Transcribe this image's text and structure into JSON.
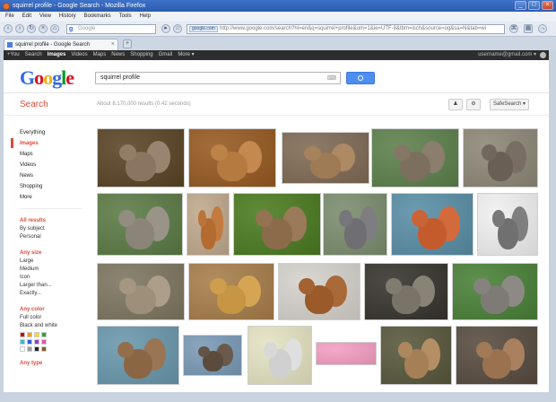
{
  "window": {
    "title": "squirrel profile - Google Search - Mozilla Firefox",
    "controls": [
      "_",
      "□",
      "×"
    ]
  },
  "menubar": [
    "File",
    "Edit",
    "View",
    "History",
    "Bookmarks",
    "Tools",
    "Help"
  ],
  "toolbar": {
    "search_placeholder": "Google",
    "url_site": "google.com",
    "url": "http://www.google.com/search?hl=en&q=squirrel+profile&um=1&ie=UTF-8&tbm=isch&source=og&sa=N&tab=wi"
  },
  "tab": {
    "title": "squirrel profile - Google Search",
    "close": "×"
  },
  "gbar": {
    "items": [
      "+You",
      "Search",
      "Images",
      "Videos",
      "Maps",
      "News",
      "Shopping",
      "Gmail",
      "More ▾"
    ],
    "active_index": 2,
    "account": "username@gmail.com ▾"
  },
  "header": {
    "logo": [
      "G",
      "o",
      "o",
      "g",
      "l",
      "e"
    ],
    "query": "squirrel profile",
    "keyboard_icon": "⌨"
  },
  "subhead": {
    "label": "Search",
    "stats": "About 8,170,000 results (0.42 seconds)",
    "safesearch": "SafeSearch ▾"
  },
  "sidebar": {
    "links": [
      "Everything",
      "Images",
      "Maps",
      "Videos",
      "News",
      "Shopping",
      "More"
    ],
    "selected_index": 1,
    "sections": [
      {
        "title": "All results",
        "items": [
          "By subject",
          "Personal"
        ]
      },
      {
        "title": "Any size",
        "items": [
          "Large",
          "Medium",
          "Icon",
          "Larger than...",
          "Exactly..."
        ]
      },
      {
        "title": "Any color",
        "items": [
          "Full color",
          "Black and white"
        ]
      }
    ],
    "swatches": [
      "#cc0000",
      "#f39c12",
      "#f1e00e",
      "#2fa43b",
      "#1ec5d6",
      "#2f5bd8",
      "#9b3cc8",
      "#e75aa8",
      "#ffffff",
      "#9a9a9a",
      "#222222",
      "#8b5a2b"
    ],
    "footer_title": "Any type"
  },
  "colors": {
    "brand_red": "#dd4b39",
    "blue": "#4d8ef0",
    "link": "#222222"
  },
  "results": [
    {
      "bg": "#6d5a3e",
      "fur": "#8a7660"
    },
    {
      "bg": "#a26d3a",
      "fur": "#b57a3f"
    },
    {
      "bg": "#8e7c68",
      "fur": "#9e7a55"
    },
    {
      "bg": "#6f8f61",
      "fur": "#7c6f5e"
    },
    {
      "bg": "#9a9586",
      "fur": "#6a5f54"
    },
    {
      "bg": "#6e8a5b",
      "fur": "#8a8578"
    },
    {
      "bg": "#c7b39a",
      "fur": "#b36b2f"
    },
    {
      "bg": "#5f8a3a",
      "fur": "#8c6b4b"
    },
    {
      "bg": "#8a9a7e",
      "fur": "#6f6e72"
    },
    {
      "bg": "#6c9bb0",
      "fur": "#c45b2d"
    },
    {
      "bg": "#f2f2f2",
      "fur": "#707070"
    },
    {
      "bg": "#8c8572",
      "fur": "#9e8f7a"
    },
    {
      "bg": "#b08c5e",
      "fur": "#c79645"
    },
    {
      "bg": "#dad7d2",
      "fur": "#9a5a2a"
    },
    {
      "bg": "#4e4a45",
      "fur": "#7a7468"
    },
    {
      "bg": "#5e8f4e",
      "fur": "#7e7b76"
    },
    {
      "bg": "#7aa3b5",
      "fur": "#8b6645"
    },
    {
      "bg": "#8aa6bf",
      "fur": "#5a4b3c"
    },
    {
      "bg": "#e8e6c8",
      "fur": "#d0d0d0"
    },
    {
      "bg": "#f6a9c9",
      "fur": "#e75aa8"
    },
    {
      "bg": "#6b6a52",
      "fur": "#a57f55"
    },
    {
      "bg": "#6a6055",
      "fur": "#9a7250"
    }
  ]
}
